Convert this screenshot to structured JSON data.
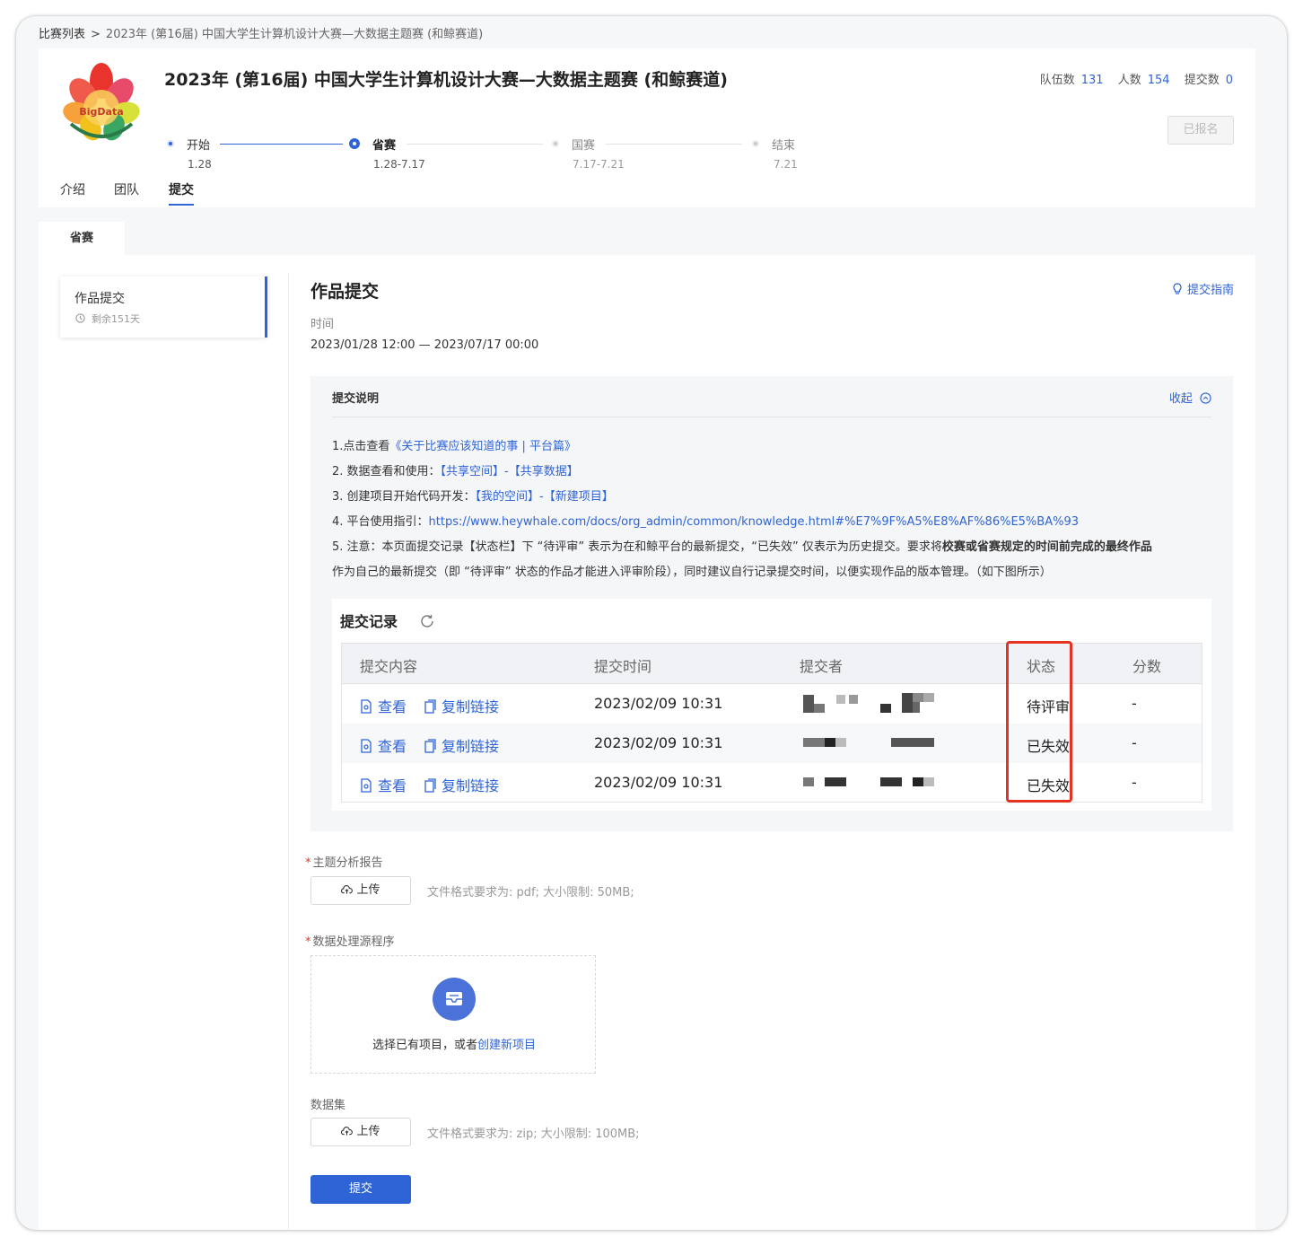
{
  "breadcrumb": {
    "root": "比赛列表",
    "separator": ">",
    "current": "2023年 (第16届) 中国大学生计算机设计大赛—大数据主题赛 (和鲸赛道)"
  },
  "header": {
    "logo_text": "BigData",
    "title": "2023年 (第16届) 中国大学生计算机设计大赛—大数据主题赛 (和鲸赛道)",
    "stats": [
      {
        "label": "队伍数",
        "value": "131"
      },
      {
        "label": "人数",
        "value": "154"
      },
      {
        "label": "提交数",
        "value": "0"
      }
    ],
    "register_label": "已报名",
    "stages": [
      {
        "name": "开始",
        "date": "1.28",
        "state": "done"
      },
      {
        "name": "省赛",
        "date": "1.28-7.17",
        "state": "current"
      },
      {
        "name": "国赛",
        "date": "7.17-7.21",
        "state": "pending"
      },
      {
        "name": "结束",
        "date": "7.21",
        "state": "pending"
      }
    ]
  },
  "nav": {
    "items": [
      "介绍",
      "团队",
      "提交"
    ],
    "active": "提交"
  },
  "round_tab": "省赛",
  "sidebar": {
    "item_title": "作品提交",
    "item_remaining": "剩余151天"
  },
  "main": {
    "title": "作品提交",
    "guide_label": "提交指南",
    "time_label": "时间",
    "time_range": "2023/01/28 12:00 — 2023/07/17 00:00"
  },
  "notes": {
    "title": "提交说明",
    "collapse_label": "收起",
    "line1_prefix": "1.点击查看",
    "line1_link": "《关于比赛应该知道的事 | 平台篇》",
    "line2_prefix": "2. 数据查看和使用：",
    "line2_link": "【共享空间】-【共享数据】",
    "line3_prefix": "3. 创建项目开始代码开发：",
    "line3_link": "【我的空间】-【新建项目】",
    "line4_prefix": "4. 平台使用指引：",
    "line4_link": "https://www.heywhale.com/docs/org_admin/common/knowledge.html#%E7%9F%A5%E8%AF%86%E5%BA%93",
    "line5_a": "5. 注意：本页面提交记录【状态栏】下 “待评审” 表示为在和鲸平台的最新提交，“已失效” 仅表示为历史提交。要求将",
    "line5_bold": "校赛或省赛规定的时间前完成的最终作品",
    "line6": "作为自己的最新提交（即 “待评审” 状态的作品才能进入评审阶段），同时建议自行记录提交时间，以便实现作品的版本管理。（如下图所示）"
  },
  "records": {
    "title": "提交记录",
    "columns": [
      "提交内容",
      "提交时间",
      "提交者",
      "状态",
      "分数"
    ],
    "view_label": "查看",
    "copy_label": "复制链接",
    "rows": [
      {
        "time": "2023/02/09 10:31",
        "status": "待评审",
        "score": "-"
      },
      {
        "time": "2023/02/09 10:31",
        "status": "已失效",
        "score": "-"
      },
      {
        "time": "2023/02/09 10:31",
        "status": "已失效",
        "score": "-"
      }
    ]
  },
  "form": {
    "report_label": "主题分析报告",
    "upload_label": "上传",
    "report_hint": "文件格式要求为: pdf; 大小限制: 50MB;",
    "source_label": "数据处理源程序",
    "source_prompt": "选择已有项目，或者",
    "source_link": "创建新项目",
    "dataset_label": "数据集",
    "dataset_hint": "文件格式要求为: zip; 大小限制: 100MB;",
    "submit_label": "提交"
  },
  "colors": {
    "accent": "#2f64d6",
    "highlight": "#e53222"
  }
}
